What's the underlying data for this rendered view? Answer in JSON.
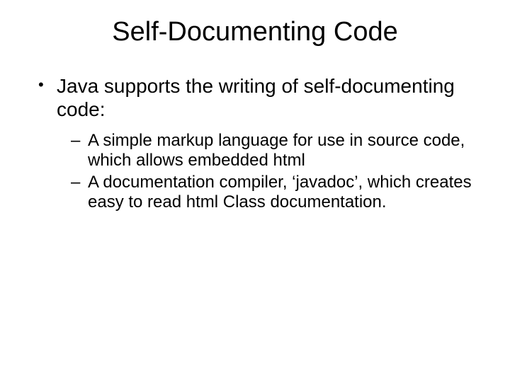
{
  "title": "Self-Documenting Code",
  "bullets": {
    "main": "Java supports the writing of self-documenting code:",
    "sub1": "A simple markup language for use in source code, which allows embedded html",
    "sub2": "A documentation compiler, ‘javadoc’, which creates easy to read html Class documentation."
  }
}
